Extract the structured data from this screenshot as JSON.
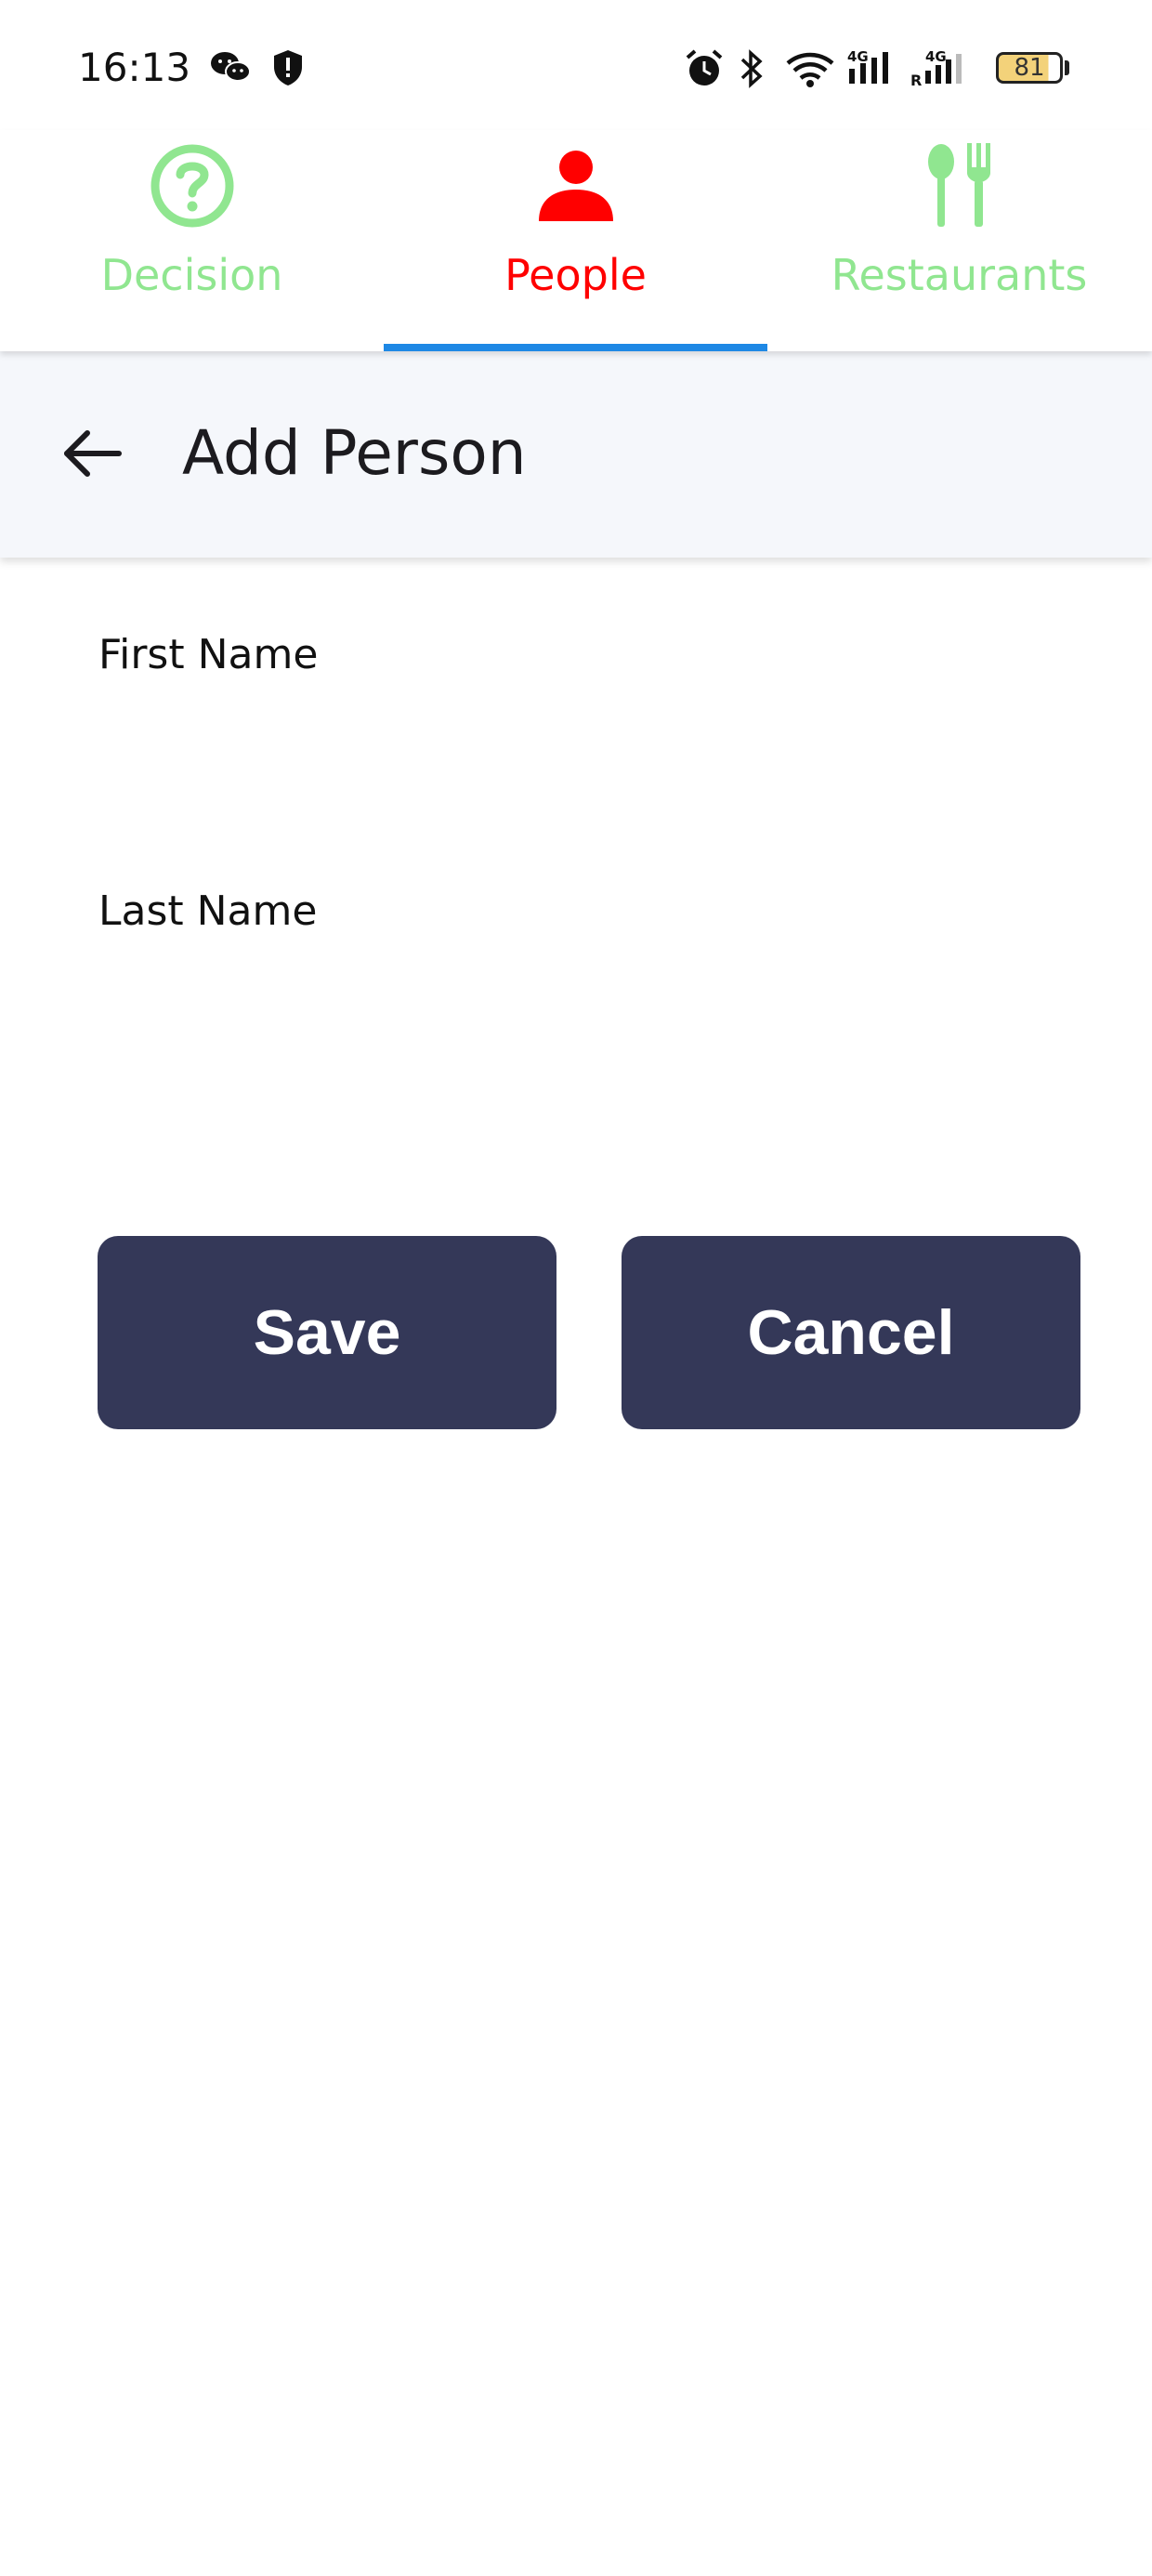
{
  "status_bar": {
    "time": "16:13",
    "battery_level": "81",
    "icons": [
      "wechat-icon",
      "shield-icon",
      "alarm-icon",
      "bluetooth-icon",
      "wifi-icon",
      "signal-4g-icon",
      "signal-4g-roaming-icon",
      "battery-icon"
    ]
  },
  "tabs": [
    {
      "label": "Decision",
      "icon": "question-circle-icon",
      "color": "#90e690",
      "selected": false
    },
    {
      "label": "People",
      "icon": "person-icon",
      "color": "#ff0000",
      "selected": true
    },
    {
      "label": "Restaurants",
      "icon": "utensils-icon",
      "color": "#90e690",
      "selected": false
    }
  ],
  "colors": {
    "tab_indicator": "#1e88e5",
    "button_background": "#343858",
    "app_bar_background": "#f5f7fb"
  },
  "app_bar": {
    "title": "Add Person"
  },
  "form": {
    "first_name": {
      "label": "First Name",
      "value": ""
    },
    "last_name": {
      "label": "Last Name",
      "value": ""
    }
  },
  "buttons": {
    "save": "Save",
    "cancel": "Cancel"
  }
}
